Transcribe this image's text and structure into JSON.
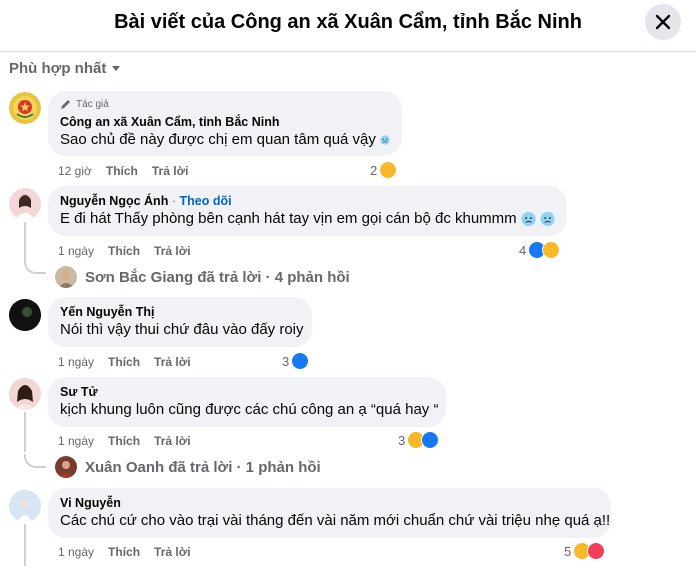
{
  "header": {
    "title": "Bài viết của Công an xã Xuân Cẩm, tỉnh Bắc Ninh"
  },
  "sort": {
    "label": "Phù hợp nhất"
  },
  "actions": {
    "like": "Thích",
    "reply": "Trả lời"
  },
  "comments": [
    {
      "author_badge": "Tác giả",
      "name": "Công an xã Xuân Cẩm, tỉnh Bắc Ninh",
      "text": "Sao chủ đề này được chị em quan tâm quá vậy",
      "time": "12 giờ",
      "reaction_count": "2",
      "reactions": [
        "haha"
      ]
    },
    {
      "name": "Nguyễn Ngọc Ánh",
      "follow": "Theo dõi",
      "text": "E đi hát Thấy phòng bên cạnh hát tay vịn em gọi cán bộ đc khummm",
      "time": "1 ngày",
      "reaction_count": "4",
      "reactions": [
        "like",
        "haha"
      ],
      "reply_summary": "Sơn Bắc Giang đã trả lời · 4 phản hồi"
    },
    {
      "name": "Yến Nguyễn Thị",
      "text": "Nói thì vậy thui chứ đâu vào đấy roiy",
      "time": "1 ngày",
      "reaction_count": "3",
      "reactions": [
        "like"
      ]
    },
    {
      "name": "Sư Tử",
      "text": "kịch khung luôn cũng được các chú công an ạ “quá hay “",
      "time": "1 ngày",
      "reaction_count": "3",
      "reactions": [
        "haha",
        "like"
      ],
      "reply_summary": "Xuân Oanh đã trả lời · 1 phản hồi"
    },
    {
      "name": "Vi Nguyễn",
      "text": "Các chú cứ cho vào trại vài tháng đến vài năm mới chuẩn chứ vài triệu nhẹ quá ạ!!",
      "time": "1 ngày",
      "reaction_count": "5",
      "reactions": [
        "haha",
        "love"
      ]
    }
  ],
  "colors": {
    "like": "#1877f2",
    "haha": "#f7b928",
    "love": "#f33e58",
    "bubble": "#f0f2f5",
    "secondary_text": "#65676b",
    "follow_link": "#0064d1"
  }
}
